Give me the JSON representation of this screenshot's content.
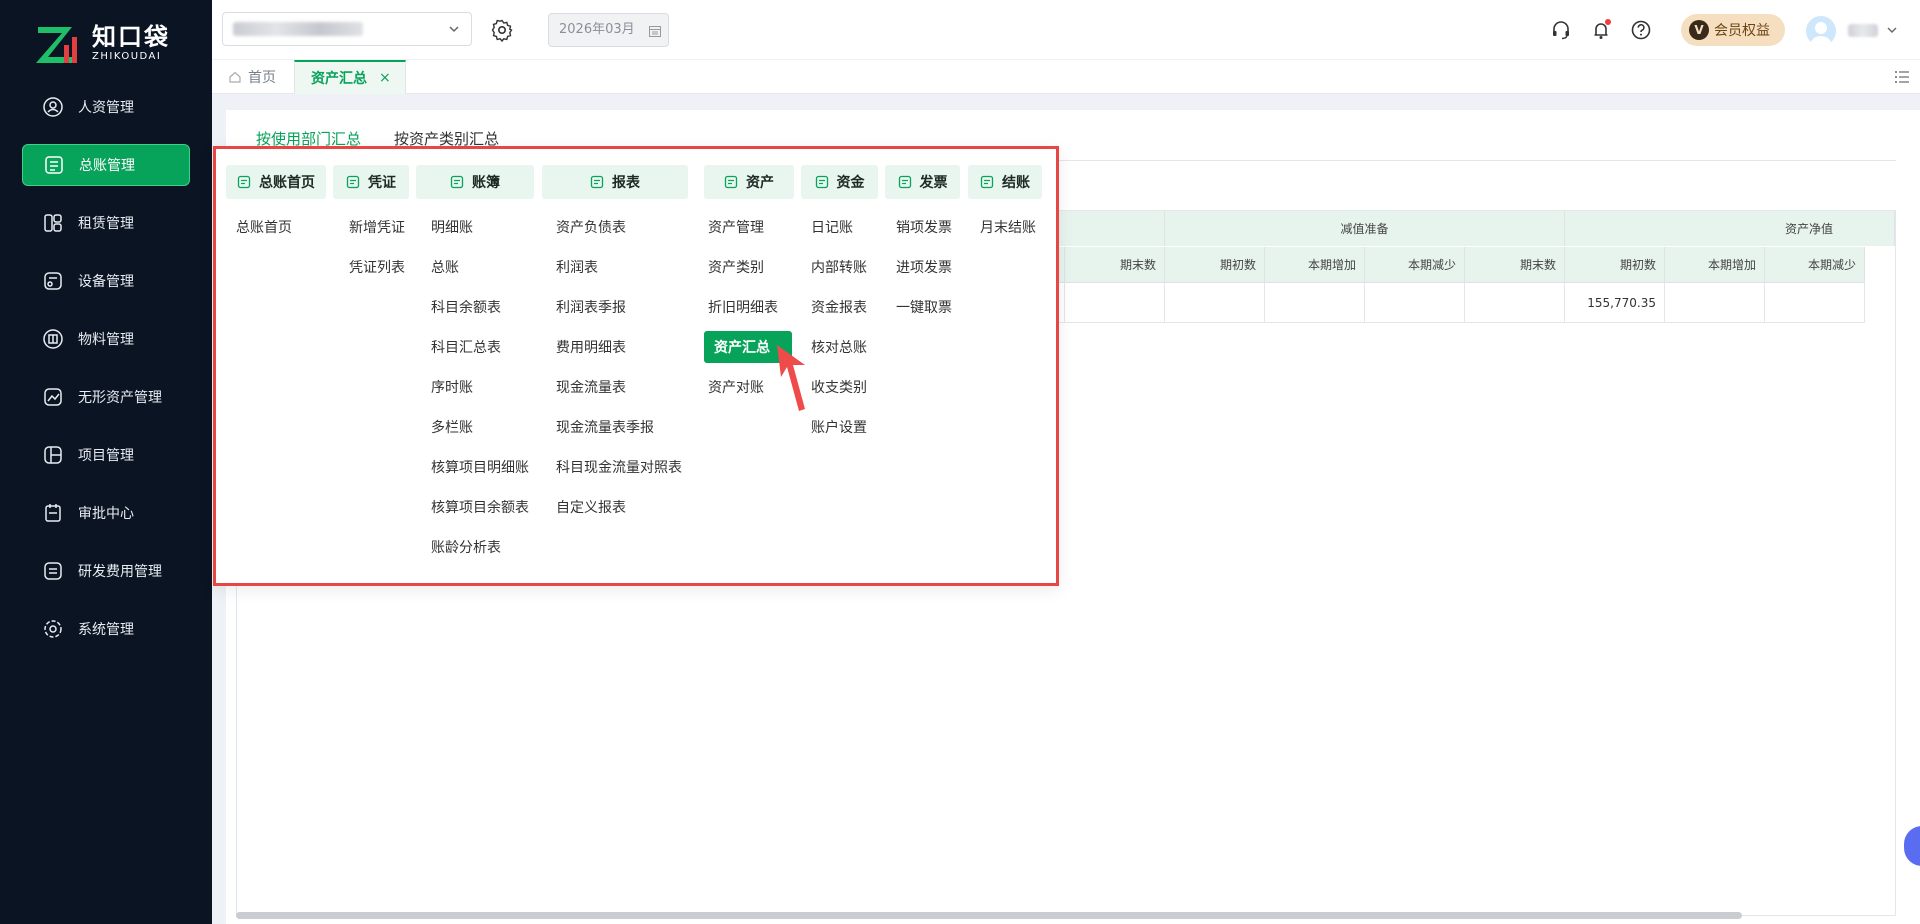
{
  "colors": {
    "brand": "#07a35a",
    "sidebar_bg": "#0b1423",
    "highlight_border": "#e84545",
    "vip_bg": "#f6dfc0"
  },
  "logo": {
    "cn": "知口袋",
    "en": "ZHIKOUDAI"
  },
  "sidebar": {
    "items": [
      {
        "label": "人资管理",
        "icon": "person-icon"
      },
      {
        "label": "总账管理",
        "icon": "ledger-icon",
        "active": true
      },
      {
        "label": "租赁管理",
        "icon": "lease-icon"
      },
      {
        "label": "设备管理",
        "icon": "device-icon"
      },
      {
        "label": "物料管理",
        "icon": "material-icon"
      },
      {
        "label": "无形资产管理",
        "icon": "intangible-icon"
      },
      {
        "label": "项目管理",
        "icon": "project-icon"
      },
      {
        "label": "审批中心",
        "icon": "approval-icon"
      },
      {
        "label": "研发费用管理",
        "icon": "rd-icon"
      },
      {
        "label": "系统管理",
        "icon": "gear-icon"
      }
    ]
  },
  "header": {
    "date_value": "2026年03月",
    "vip_label": "会员权益",
    "vip_badge": "V"
  },
  "tabs": {
    "home": "首页",
    "active": "资产汇总",
    "close": "×"
  },
  "subtabs": [
    "按使用部门汇总",
    "按资产类别汇总"
  ],
  "table": {
    "groups": [
      "减值准备",
      "资产净值"
    ],
    "headers": [
      "期末数",
      "期初数",
      "本期增加",
      "本期减少",
      "期末数",
      "期初数",
      "本期增加",
      "本期减少"
    ],
    "row": [
      "",
      "",
      "",
      "",
      "",
      "155,770.35",
      "",
      ""
    ]
  },
  "mega_menu": {
    "columns": [
      {
        "title": "总账首页",
        "icon": "home-ledger-icon",
        "items": [
          "总账首页"
        ]
      },
      {
        "title": "凭证",
        "icon": "voucher-icon",
        "items": [
          "新增凭证",
          "凭证列表"
        ]
      },
      {
        "title": "账簿",
        "icon": "book-icon",
        "items": [
          "明细账",
          "总账",
          "科目余额表",
          "科目汇总表",
          "序时账",
          "多栏账",
          "核算项目明细账",
          "核算项目余额表",
          "账龄分析表"
        ]
      },
      {
        "title": "报表",
        "icon": "report-icon",
        "items": [
          "资产负债表",
          "利润表",
          "利润表季报",
          "费用明细表",
          "现金流量表",
          "现金流量表季报",
          "科目现金流量对照表",
          "自定义报表"
        ]
      },
      {
        "title": "资产",
        "icon": "asset-icon",
        "items": [
          "资产管理",
          "资产类别",
          "折旧明细表",
          "资产汇总",
          "资产对账"
        ],
        "selected": "资产汇总"
      },
      {
        "title": "资金",
        "icon": "fund-icon",
        "items": [
          "日记账",
          "内部转账",
          "资金报表",
          "核对总账",
          "收支类别",
          "账户设置"
        ]
      },
      {
        "title": "发票",
        "icon": "invoice-icon",
        "items": [
          "销项发票",
          "进项发票",
          "一键取票"
        ]
      },
      {
        "title": "结账",
        "icon": "close-books-icon",
        "items": [
          "月末结账"
        ]
      }
    ]
  }
}
